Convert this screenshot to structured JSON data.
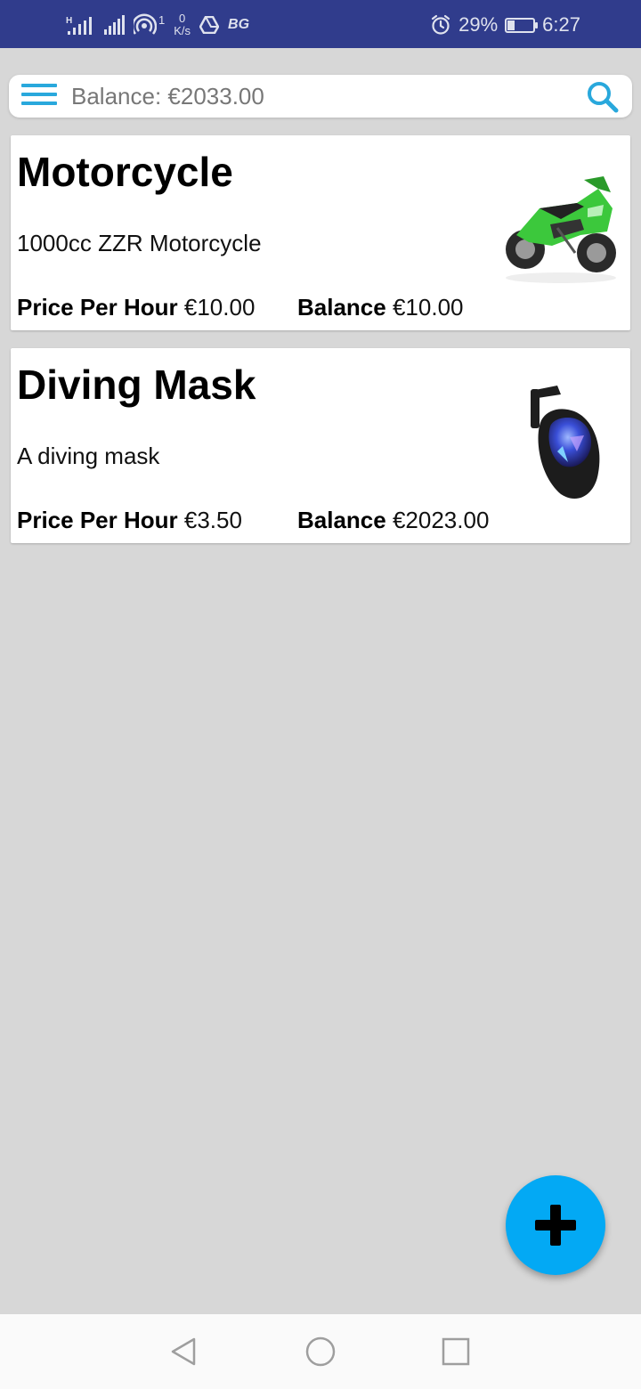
{
  "status_bar": {
    "net_speed_value": "0",
    "net_speed_unit": "K/s",
    "hotspot_count": "1",
    "carrier_tag": "BG",
    "battery_percent": "29%",
    "battery_level": 0.29,
    "time": "6:27"
  },
  "search": {
    "placeholder": "Balance: €2033.00"
  },
  "items": [
    {
      "title": "Motorcycle",
      "description": "1000cc ZZR Motorcycle",
      "price_label": "Price Per Hour",
      "price_value": "€10.00",
      "balance_label": "Balance",
      "balance_value": "€10.00",
      "image_icon": "motorcycle-image"
    },
    {
      "title": "Diving Mask",
      "description": "A diving mask",
      "price_label": "Price Per Hour",
      "price_value": "€3.50",
      "balance_label": "Balance",
      "balance_value": "€2023.00",
      "image_icon": "diving-mask-image"
    }
  ],
  "colors": {
    "status_bar": "#303c8c",
    "accent": "#29a8dc",
    "fab": "#03a9f4",
    "background": "#d7d7d7"
  }
}
